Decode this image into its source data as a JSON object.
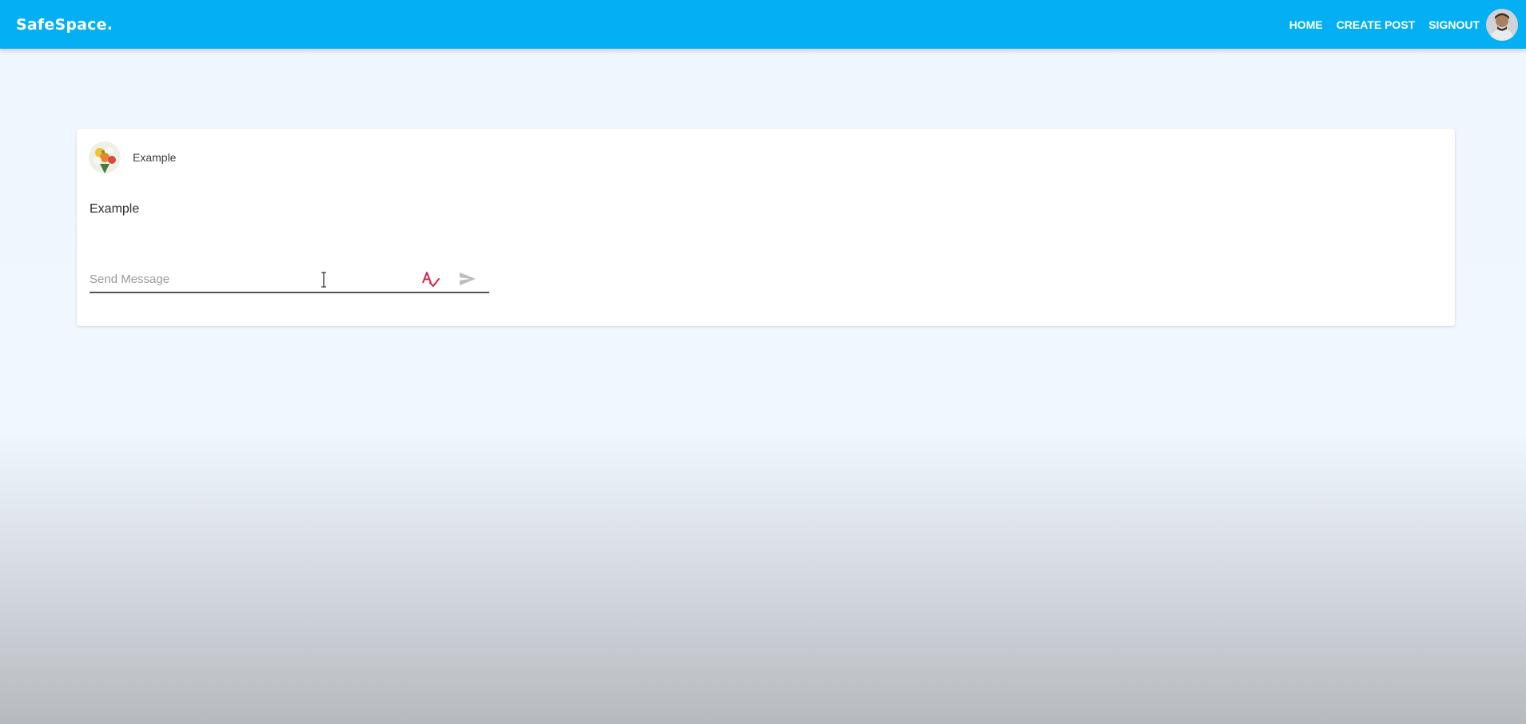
{
  "navbar": {
    "brand": "SafeSpace.",
    "links": [
      "HOME",
      "CREATE POST",
      "SIGNOUT"
    ],
    "avatar_icon": "user-avatar-photo",
    "background_color": "#04b0f3"
  },
  "post": {
    "author": "Example",
    "avatar_icon": "flower-bouquet-photo",
    "body": "Example",
    "message_input": {
      "placeholder": "Send Message",
      "value": ""
    },
    "icons": {
      "spellcheck": "spellcheck-icon",
      "send": "send-icon"
    }
  },
  "colors": {
    "spellcheck": "#d2264e",
    "send_disabled": "#bdbdbd"
  }
}
